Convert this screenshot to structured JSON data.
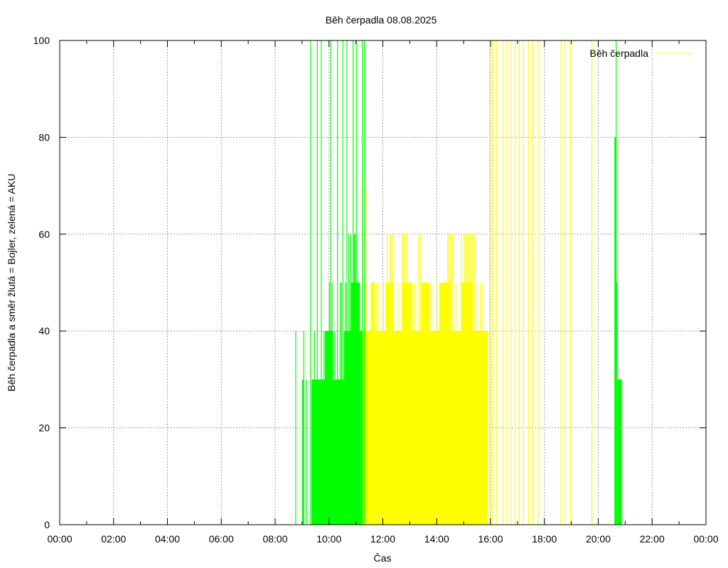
{
  "chart_data": {
    "type": "bar",
    "title": "Běh čerpadla 08.08.2025",
    "xlabel": "Čas",
    "ylabel": "Běh čerpadla a směr žlutá = Bojler, zelená = AKU",
    "xlim": [
      0,
      24
    ],
    "ylim": [
      0,
      100
    ],
    "x_ticks": [
      "00:00",
      "02:00",
      "04:00",
      "06:00",
      "08:00",
      "10:00",
      "12:00",
      "14:00",
      "16:00",
      "18:00",
      "20:00",
      "22:00",
      "00:00"
    ],
    "y_ticks": [
      "0",
      "20",
      "40",
      "60",
      "80",
      "100"
    ],
    "grid": true,
    "legend": {
      "position": "top-right",
      "entries": [
        "Běh čerpadla"
      ]
    },
    "colors": {
      "series": "#ffff00",
      "aku": "#00ff00"
    },
    "series": [
      {
        "name": "Běh čerpadla",
        "color": "#ffff00",
        "segments": [
          {
            "x0": 11.2,
            "x1": 11.55,
            "y": 40
          },
          {
            "x0": 11.55,
            "x1": 11.7,
            "y": 50
          },
          {
            "x0": 11.7,
            "x1": 12.1,
            "y": 40
          },
          {
            "x0": 12.1,
            "x1": 12.4,
            "y": 50
          },
          {
            "x0": 12.4,
            "x1": 12.7,
            "y": 40
          },
          {
            "x0": 12.7,
            "x1": 13.1,
            "y": 50
          },
          {
            "x0": 13.1,
            "x1": 13.4,
            "y": 40
          },
          {
            "x0": 13.4,
            "x1": 13.75,
            "y": 50
          },
          {
            "x0": 13.75,
            "x1": 14.1,
            "y": 40
          },
          {
            "x0": 14.1,
            "x1": 14.5,
            "y": 50
          },
          {
            "x0": 14.5,
            "x1": 14.9,
            "y": 40
          },
          {
            "x0": 14.9,
            "x1": 15.3,
            "y": 50
          },
          {
            "x0": 15.3,
            "x1": 15.9,
            "y": 40
          }
        ],
        "spikes": [
          {
            "x": 11.3,
            "y": 50
          },
          {
            "x": 11.35,
            "y": 70
          },
          {
            "x": 11.4,
            "y": 50
          },
          {
            "x": 11.6,
            "y": 50
          },
          {
            "x": 11.75,
            "y": 50
          },
          {
            "x": 11.85,
            "y": 50
          },
          {
            "x": 12.0,
            "y": 50
          },
          {
            "x": 12.15,
            "y": 60
          },
          {
            "x": 12.25,
            "y": 60
          },
          {
            "x": 12.3,
            "y": 60
          },
          {
            "x": 12.35,
            "y": 60
          },
          {
            "x": 12.55,
            "y": 50
          },
          {
            "x": 12.7,
            "y": 60
          },
          {
            "x": 12.75,
            "y": 60
          },
          {
            "x": 12.8,
            "y": 60
          },
          {
            "x": 12.85,
            "y": 60
          },
          {
            "x": 13.0,
            "y": 50
          },
          {
            "x": 13.15,
            "y": 50
          },
          {
            "x": 13.3,
            "y": 60
          },
          {
            "x": 13.4,
            "y": 60
          },
          {
            "x": 13.5,
            "y": 50
          },
          {
            "x": 13.7,
            "y": 50
          },
          {
            "x": 13.8,
            "y": 50
          },
          {
            "x": 14.0,
            "y": 50
          },
          {
            "x": 14.2,
            "y": 50
          },
          {
            "x": 14.3,
            "y": 50
          },
          {
            "x": 14.4,
            "y": 60
          },
          {
            "x": 14.45,
            "y": 60
          },
          {
            "x": 14.5,
            "y": 60
          },
          {
            "x": 14.55,
            "y": 60
          },
          {
            "x": 14.6,
            "y": 60
          },
          {
            "x": 14.7,
            "y": 50
          },
          {
            "x": 14.9,
            "y": 60
          },
          {
            "x": 15.0,
            "y": 60
          },
          {
            "x": 15.05,
            "y": 60
          },
          {
            "x": 15.1,
            "y": 60
          },
          {
            "x": 15.15,
            "y": 60
          },
          {
            "x": 15.2,
            "y": 60
          },
          {
            "x": 15.25,
            "y": 60
          },
          {
            "x": 15.3,
            "y": 60
          },
          {
            "x": 15.35,
            "y": 60
          },
          {
            "x": 15.4,
            "y": 60
          },
          {
            "x": 15.5,
            "y": 50
          },
          {
            "x": 15.6,
            "y": 50
          },
          {
            "x": 15.7,
            "y": 50
          },
          {
            "x": 15.8,
            "y": 40
          },
          {
            "x": 15.95,
            "y": 100
          },
          {
            "x": 16.05,
            "y": 100
          },
          {
            "x": 16.2,
            "y": 100
          },
          {
            "x": 16.45,
            "y": 100
          },
          {
            "x": 16.6,
            "y": 100
          },
          {
            "x": 16.75,
            "y": 100
          },
          {
            "x": 16.9,
            "y": 100
          },
          {
            "x": 17.05,
            "y": 100
          },
          {
            "x": 17.2,
            "y": 100
          },
          {
            "x": 17.4,
            "y": 100
          },
          {
            "x": 17.55,
            "y": 100
          },
          {
            "x": 17.75,
            "y": 100
          },
          {
            "x": 18.6,
            "y": 100
          },
          {
            "x": 18.75,
            "y": 100
          },
          {
            "x": 18.95,
            "y": 100
          },
          {
            "x": 19.75,
            "y": 100
          }
        ]
      },
      {
        "name": "",
        "color": "#00ff00",
        "segments": [
          {
            "x0": 9.0,
            "x1": 9.05,
            "y": 30
          },
          {
            "x0": 9.35,
            "x1": 9.85,
            "y": 30
          },
          {
            "x0": 9.85,
            "x1": 10.15,
            "y": 40
          },
          {
            "x0": 10.15,
            "x1": 10.55,
            "y": 30
          },
          {
            "x0": 10.55,
            "x1": 10.85,
            "y": 40
          },
          {
            "x0": 10.85,
            "x1": 11.15,
            "y": 50
          },
          {
            "x0": 11.15,
            "x1": 11.25,
            "y": 40
          },
          {
            "x0": 20.6,
            "x1": 20.68,
            "y": 80
          },
          {
            "x0": 20.68,
            "x1": 20.72,
            "y": 50
          },
          {
            "x0": 20.72,
            "x1": 20.88,
            "y": 30
          }
        ],
        "spikes": [
          {
            "x": 8.75,
            "y": 40
          },
          {
            "x": 9.05,
            "y": 40
          },
          {
            "x": 9.15,
            "y": 30
          },
          {
            "x": 9.3,
            "y": 100
          },
          {
            "x": 9.45,
            "y": 40
          },
          {
            "x": 9.55,
            "y": 100
          },
          {
            "x": 9.7,
            "y": 100
          },
          {
            "x": 9.8,
            "y": 40
          },
          {
            "x": 9.9,
            "y": 40
          },
          {
            "x": 10.0,
            "y": 50
          },
          {
            "x": 10.05,
            "y": 100
          },
          {
            "x": 10.1,
            "y": 50
          },
          {
            "x": 10.2,
            "y": 40
          },
          {
            "x": 10.3,
            "y": 100
          },
          {
            "x": 10.4,
            "y": 50
          },
          {
            "x": 10.45,
            "y": 50
          },
          {
            "x": 10.5,
            "y": 100
          },
          {
            "x": 10.6,
            "y": 50
          },
          {
            "x": 10.65,
            "y": 100
          },
          {
            "x": 10.72,
            "y": 60
          },
          {
            "x": 10.78,
            "y": 60
          },
          {
            "x": 10.82,
            "y": 50
          },
          {
            "x": 10.88,
            "y": 100
          },
          {
            "x": 10.92,
            "y": 60
          },
          {
            "x": 10.96,
            "y": 60
          },
          {
            "x": 11.0,
            "y": 100
          },
          {
            "x": 11.05,
            "y": 50
          },
          {
            "x": 11.1,
            "y": 40
          },
          {
            "x": 11.22,
            "y": 100
          },
          {
            "x": 11.3,
            "y": 100
          },
          {
            "x": 20.65,
            "y": 100
          }
        ]
      }
    ]
  }
}
